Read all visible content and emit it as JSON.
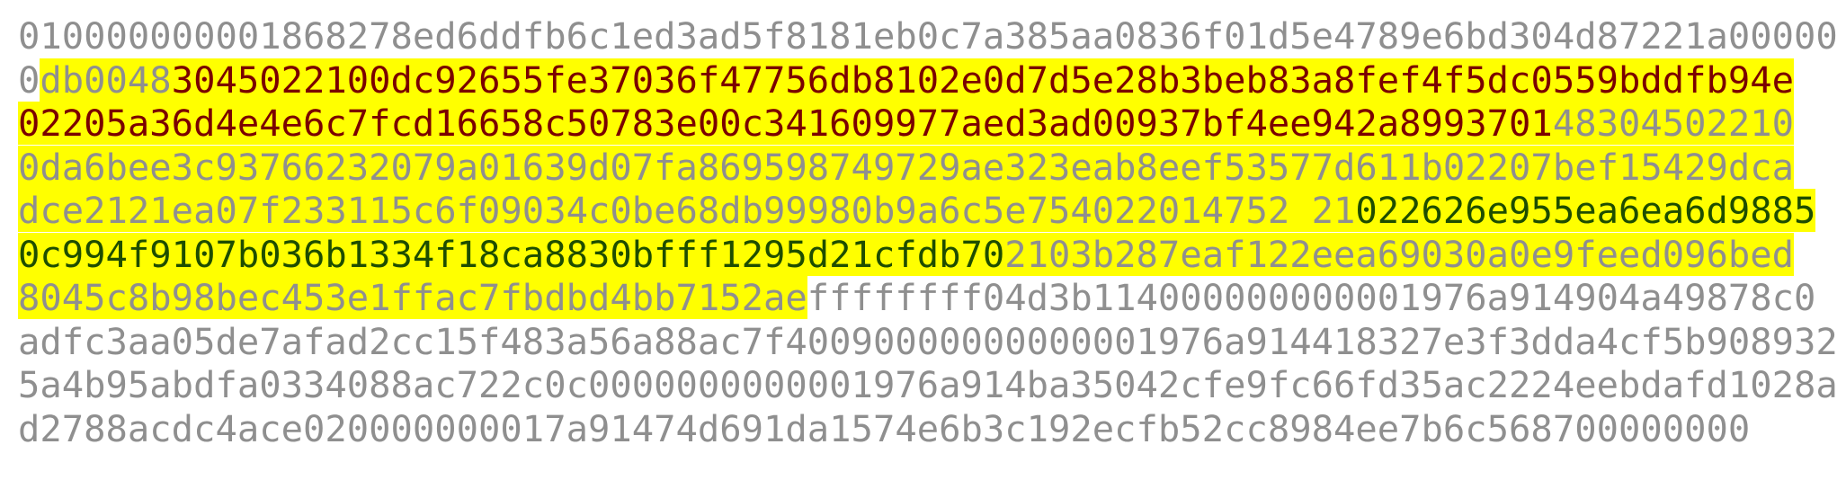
{
  "colors": {
    "plain_text": "#8f8f8f",
    "highlight_background": "#ffff00",
    "highlight_red_text": "#7a0000",
    "highlight_green_text": "#1e4d00"
  },
  "lines": [
    [
      {
        "style": "plain",
        "text": "010000000001868278ed6ddfb6c1ed3ad5f8181eb0c7a385aa0836f01d5e4789e6bd304d87221a00000"
      }
    ],
    [
      {
        "style": "plain",
        "text": "0"
      },
      {
        "style": "hl-grey",
        "text": "db0048"
      },
      {
        "style": "hl-red",
        "text": "3045022100dc92655fe37036f47756db8102e0d7d5e28b3beb83a8fef4f5dc0559bddfb94e"
      }
    ],
    [
      {
        "style": "hl-red",
        "text": "02205a36d4e4e6c7fcd16658c50783e00c341609977aed3ad00937bf4ee942a8993701"
      },
      {
        "style": "hl-grey",
        "text": "48304502210"
      }
    ],
    [
      {
        "style": "hl-grey",
        "text": "0da6bee3c93766232079a01639d07fa869598749729ae323eab8eef53577d611b02207bef15429dca"
      }
    ],
    [
      {
        "style": "hl-grey",
        "text": "dce2121ea07f233115c6f09034c0be68db99980b9a6c5e754022014752 21"
      },
      {
        "style": "hl-green",
        "text": "022626e955ea6ea6d9885"
      }
    ],
    [
      {
        "style": "hl-green",
        "text": "0c994f9107b036b1334f18ca8830bfff1295d21cfdb70"
      },
      {
        "style": "hl-grey",
        "text": "2103b287eaf122eea69030a0e9feed096bed"
      }
    ],
    [
      {
        "style": "hl-grey",
        "text": "8045c8b98bec453e1ffac7fbdbd4bb7152ae"
      },
      {
        "style": "plain",
        "text": "ffffffff04d3b114000000000001976a914904a49878c0"
      }
    ],
    [
      {
        "style": "plain",
        "text": "adfc3aa05de7afad2cc15f483a56a88ac7f40090000000000001976a914418327e3f3dda4cf5b908932"
      }
    ],
    [
      {
        "style": "plain",
        "text": "5a4b95abdfa0334088ac722c0c0000000000001976a914ba35042cfe9fc66fd35ac2224eebdafd1028a"
      }
    ],
    [
      {
        "style": "plain",
        "text": "d2788acdc4ace020000000017a91474d691da1574e6b3c192ecfb52cc8984ee7b6c568700000000"
      }
    ]
  ]
}
